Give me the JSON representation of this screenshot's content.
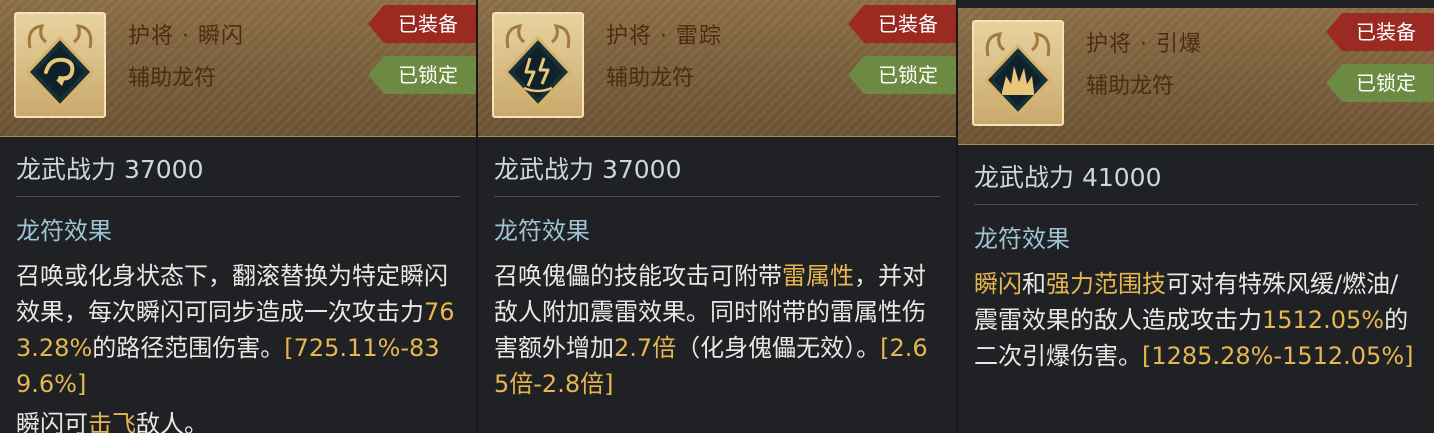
{
  "cards": [
    {
      "name": "护将 · 瞬闪",
      "type": "辅助龙符",
      "equipped_label": "已装备",
      "locked_label": "已锁定",
      "icon": "dash-swirl-icon",
      "power": "龙武战力 37000",
      "section_title": "龙符效果",
      "desc_a": "召唤或化身状态下，翻滚替换为特定瞬闪效果，每次瞬闪可同步造成一次攻击力",
      "desc_value": "763.28%",
      "desc_b": "的路径范围伤害。",
      "desc_range": "[725.11%-839.6%]",
      "extra_a": "瞬闪可",
      "extra_hl": "击飞",
      "extra_b": "敌人。"
    },
    {
      "name": "护将 · 雷踪",
      "type": "辅助龙符",
      "equipped_label": "已装备",
      "locked_label": "已锁定",
      "icon": "thunder-icon",
      "power": "龙武战力 37000",
      "section_title": "龙符效果",
      "desc_a": "召唤傀儡的技能攻击可附带",
      "desc_hl": "雷属性",
      "desc_b": "，并对敌人附加震雷效果。同时附带的雷属性伤害额外增加",
      "desc_value": "2.7倍",
      "desc_c": "（化身傀儡无效）。",
      "desc_range": "[2.65倍-2.8倍]"
    },
    {
      "name": "护将 · 引爆",
      "type": "辅助龙符",
      "equipped_label": "已装备",
      "locked_label": "已锁定",
      "icon": "explosion-icon",
      "power": "龙武战力 41000",
      "section_title": "龙符效果",
      "desc_hl1": "瞬闪",
      "desc_a": "和",
      "desc_hl2": "强力范围技",
      "desc_b": "可对有特殊风缓/燃油/震雷效果的敌人造成攻击力",
      "desc_value": "1512.05%",
      "desc_c": "的二次引爆伤害。",
      "desc_range": "[1285.28%-1512.05%]"
    }
  ],
  "colors": {
    "header": "#7b5f3c",
    "equipped_badge": "#9a2a22",
    "locked_badge": "#6d8a42",
    "highlight": "#e6b64f",
    "section": "#9fc4d4"
  }
}
